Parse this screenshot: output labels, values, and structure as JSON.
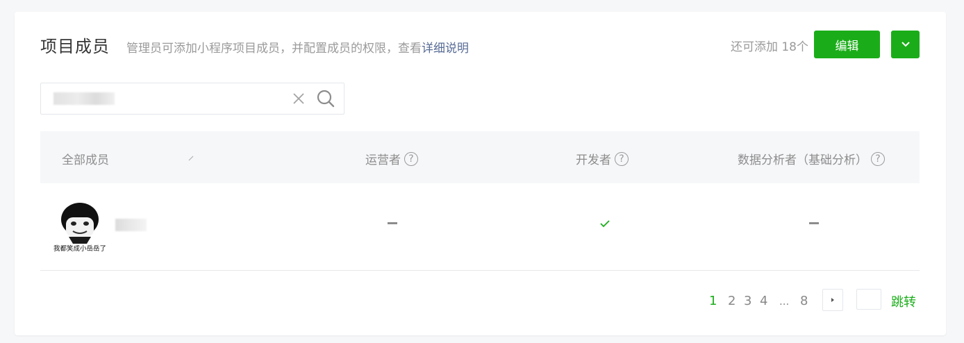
{
  "header": {
    "title": "项目成员",
    "description": "管理员可添加小程序项目成员，并配置成员的权限，查看",
    "detail_link": "详细说明",
    "quota": "还可添加 18个",
    "edit_label": "编辑"
  },
  "search": {
    "value": "",
    "placeholder": ""
  },
  "table": {
    "columns": [
      {
        "label": "全部成员"
      },
      {
        "label": "运营者",
        "help": "?"
      },
      {
        "label": "开发者",
        "help": "?"
      },
      {
        "label": "数据分析者（基础分析）",
        "help": "?"
      }
    ],
    "rows": [
      {
        "avatar_caption": "我都笑成小岳岳了",
        "operator": "none",
        "developer": "checked",
        "analyst": "none"
      }
    ]
  },
  "pagination": {
    "pages": [
      "1",
      "2",
      "3",
      "4",
      "...",
      "8"
    ],
    "current": "1",
    "jump_label": "跳转",
    "jump_value": ""
  },
  "colors": {
    "primary": "#1aad19",
    "link": "#576b95",
    "header_bg": "#f6f7f9"
  }
}
